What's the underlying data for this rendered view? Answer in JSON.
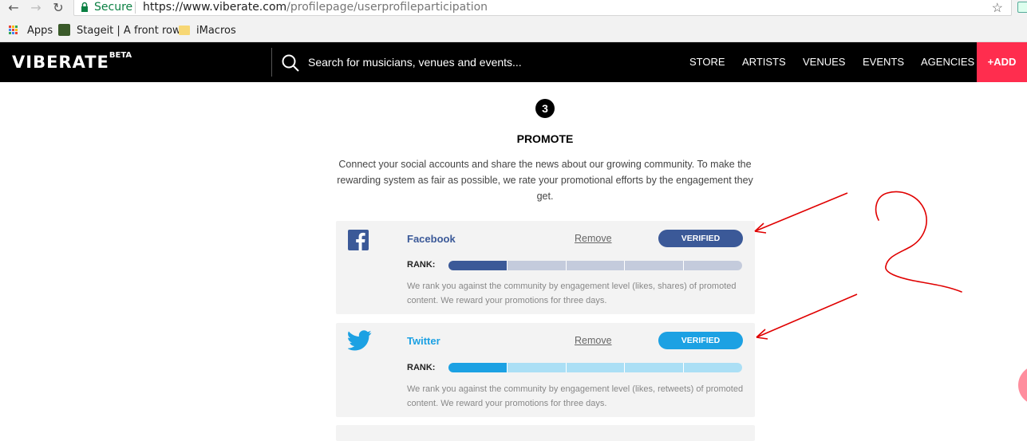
{
  "browser": {
    "secure_label": "Secure",
    "url_host": "https://www.viberate.com",
    "url_path": "/profilepage/userprofileparticipation",
    "bookmarks": {
      "apps": "Apps",
      "stageit": "Stageit | A front row s",
      "imacros": "iMacros"
    }
  },
  "header": {
    "logo": "VIBERATE",
    "logo_badge": "BETA",
    "search_placeholder": "Search for musicians, venues and events...",
    "nav": [
      "STORE",
      "ARTISTS",
      "VENUES",
      "EVENTS",
      "AGENCIES"
    ],
    "add_label": "+ADD"
  },
  "promote": {
    "step_number": "3",
    "title": "PROMOTE",
    "description": "Connect your social accounts and share the news about our growing community. To make the rewarding system as fair as possible, we rate your promotional efforts by the engagement they get."
  },
  "cards": [
    {
      "network": "Facebook",
      "remove_label": "Remove",
      "status": "VERIFIED",
      "rank_label": "RANK:",
      "rank_filled_segments": 1,
      "rank_total_segments": 5,
      "note": "We rank you against the community by engagement level (likes, shares) of promoted content. We reward your promotions for three days.",
      "color": "#3b5998",
      "track_color": "#c4cbdc"
    },
    {
      "network": "Twitter",
      "remove_label": "Remove",
      "status": "VERIFIED",
      "rank_label": "RANK:",
      "rank_filled_segments": 1,
      "rank_total_segments": 5,
      "note": "We rank you against the community by engagement level (likes, retweets) of promoted content. We reward your promotions for three days.",
      "color": "#1ca1e3",
      "track_color": "#abdff5"
    }
  ],
  "annotation": {
    "color": "#e00000",
    "handwritten_label": "2"
  }
}
